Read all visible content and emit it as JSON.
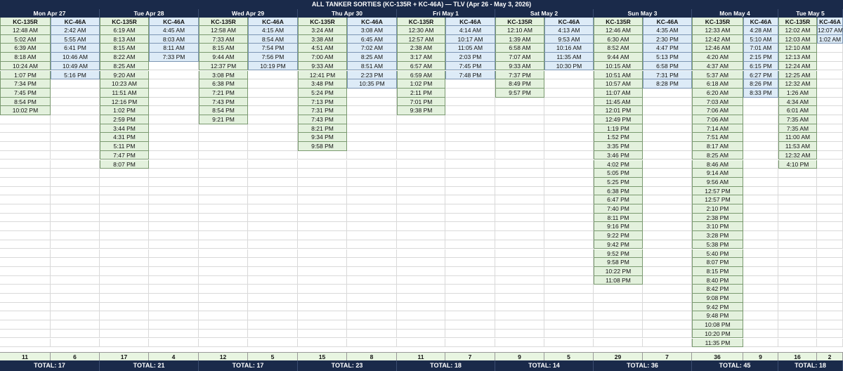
{
  "sheet": {
    "title": "ALL TANKER SORTIES (KC-135R + KC-46A) — TLV (Apr 26 - May 3, 2026)",
    "type_labels": [
      "KC-135R",
      "KC-46A"
    ],
    "colors": {
      "header_bg": "#1a2a4a",
      "header_text": "#ffffff",
      "kc135_fill": "#e3f1dd",
      "kc46_fill": "#ddebf7",
      "count_fill": "#e8f5e1"
    },
    "days": [
      {
        "label": "Mon Apr 27",
        "kc135": [
          "12:48 AM",
          "5:02 AM",
          "6:39 AM",
          "8:18 AM",
          "10:24 AM",
          "1:07 PM",
          "7:34 PM",
          "7:45 PM",
          "8:54 PM",
          "10:02 PM"
        ],
        "kc46": [
          "2:42 AM",
          "5:55 AM",
          "6:41 PM",
          "10:46 AM",
          "10:49 AM",
          "5:16 PM"
        ],
        "kc135_count": "11",
        "kc46_count": "6",
        "total": "TOTAL: 17"
      },
      {
        "label": "Tue Apr 28",
        "kc135": [
          "6:19 AM",
          "8:13 AM",
          "8:15 AM",
          "8:22 AM",
          "8:25 AM",
          "9:20 AM",
          "10:23 AM",
          "11:51 AM",
          "12:16 PM",
          "1:02 PM",
          "2:59 PM",
          "3:44 PM",
          "4:31 PM",
          "5:11 PM",
          "7:47 PM",
          "8:07 PM"
        ],
        "kc46": [
          "4:45 AM",
          "8:03 AM",
          "8:11 AM",
          "7:33 PM"
        ],
        "kc135_count": "17",
        "kc46_count": "4",
        "total": "TOTAL: 21"
      },
      {
        "label": "Wed Apr 29",
        "kc135": [
          "12:58 AM",
          "7:33 AM",
          "8:15 AM",
          "9:44 AM",
          "12:37 PM",
          "3:08 PM",
          "6:38 PM",
          "7:21 PM",
          "7:43 PM",
          "8:54 PM",
          "9:21 PM"
        ],
        "kc46": [
          "4:15 AM",
          "8:54 AM",
          "7:54 PM",
          "7:56 PM",
          "10:19 PM"
        ],
        "kc135_count": "12",
        "kc46_count": "5",
        "total": "TOTAL: 17"
      },
      {
        "label": "Thu Apr 30",
        "kc135": [
          "3:24 AM",
          "3:38 AM",
          "4:51 AM",
          "7:00 AM",
          "9:33 AM",
          "12:41 PM",
          "3:48 PM",
          "5:24 PM",
          "7:13 PM",
          "7:31 PM",
          "7:43 PM",
          "8:21 PM",
          "9:34 PM",
          "9:58 PM"
        ],
        "kc46": [
          "3:08 AM",
          "6:45 AM",
          "7:02 AM",
          "8:25 AM",
          "8:51 AM",
          "2:23 PM",
          "10:35 PM"
        ],
        "kc135_count": "15",
        "kc46_count": "8",
        "total": "TOTAL: 23"
      },
      {
        "label": "Fri May 1",
        "kc135": [
          "12:30 AM",
          "12:57 AM",
          "2:38 AM",
          "3:17 AM",
          "6:57 AM",
          "6:59 AM",
          "1:02 PM",
          "2:11 PM",
          "7:01 PM",
          "9:38 PM"
        ],
        "kc46": [
          "4:14 AM",
          "10:17 AM",
          "11:05 AM",
          "2:03 PM",
          "7:45 PM",
          "7:48 PM"
        ],
        "kc135_count": "11",
        "kc46_count": "7",
        "total": "TOTAL: 18"
      },
      {
        "label": "Sat May 2",
        "kc135": [
          "12:10 AM",
          "1:39 AM",
          "6:58 AM",
          "7:07 AM",
          "9:33 AM",
          "7:37 PM",
          "8:49 PM",
          "9:57 PM"
        ],
        "kc46": [
          "4:13 AM",
          "9:53 AM",
          "10:16 AM",
          "11:35 AM",
          "10:30 PM"
        ],
        "kc135_count": "9",
        "kc46_count": "5",
        "total": "TOTAL: 14"
      },
      {
        "label": "Sun May 3",
        "kc135": [
          "12:46 AM",
          "6:30 AM",
          "8:52 AM",
          "9:44 AM",
          "10:15 AM",
          "10:51 AM",
          "10:57 AM",
          "11:07 AM",
          "11:45 AM",
          "12:01 PM",
          "12:49 PM",
          "1:19 PM",
          "1:52 PM",
          "3:35 PM",
          "3:46 PM",
          "4:02 PM",
          "5:05 PM",
          "5:25 PM",
          "6:38 PM",
          "6:47 PM",
          "7:40 PM",
          "8:11 PM",
          "9:16 PM",
          "9:22 PM",
          "9:42 PM",
          "9:52 PM",
          "9:58 PM",
          "10:22 PM",
          "11:08 PM"
        ],
        "kc46": [
          "4:35 AM",
          "2:30 PM",
          "4:47 PM",
          "5:13 PM",
          "6:58 PM",
          "7:31 PM",
          "8:28 PM"
        ],
        "kc135_count": "29",
        "kc46_count": "7",
        "total": "TOTAL: 36"
      },
      {
        "label": "Mon May 4",
        "kc135": [
          "12:33 AM",
          "12:42 AM",
          "12:46 AM",
          "4:20 AM",
          "4:37 AM",
          "5:37 AM",
          "6:18 AM",
          "6:20 AM",
          "7:03 AM",
          "7:06 AM",
          "7:06 AM",
          "7:14 AM",
          "7:51 AM",
          "8:17 AM",
          "8:25 AM",
          "8:46 AM",
          "9:14 AM",
          "9:56 AM",
          "12:57 PM",
          "12:57 PM",
          "2:10 PM",
          "2:38 PM",
          "3:10 PM",
          "3:28 PM",
          "5:38 PM",
          "5:40 PM",
          "8:07 PM",
          "8:15 PM",
          "8:40 PM",
          "8:42 PM",
          "9:08 PM",
          "9:42 PM",
          "9:48 PM",
          "10:08 PM",
          "10:20 PM",
          "11:35 PM"
        ],
        "kc46": [
          "4:28 AM",
          "5:10 AM",
          "7:01 AM",
          "2:15 PM",
          "6:15 PM",
          "6:27 PM",
          "8:26 PM",
          "8:33 PM"
        ],
        "kc135_count": "36",
        "kc46_count": "9",
        "total": "TOTAL: 45"
      },
      {
        "label": "Tue May 5",
        "kc135": [
          "12:02 AM",
          "12:03 AM",
          "12:10 AM",
          "12:13 AM",
          "12:24 AM",
          "12:25 AM",
          "12:32 AM",
          "1:26 AM",
          "4:34 AM",
          "6:01 AM",
          "7:35 AM",
          "7:35 AM",
          "11:00 AM",
          "11:53 AM",
          "12:32 AM",
          "4:10 PM"
        ],
        "kc46": [
          "12:07 AM",
          "1:02 AM"
        ],
        "kc135_count": "16",
        "kc46_count": "2",
        "total": "TOTAL: 18"
      }
    ]
  }
}
